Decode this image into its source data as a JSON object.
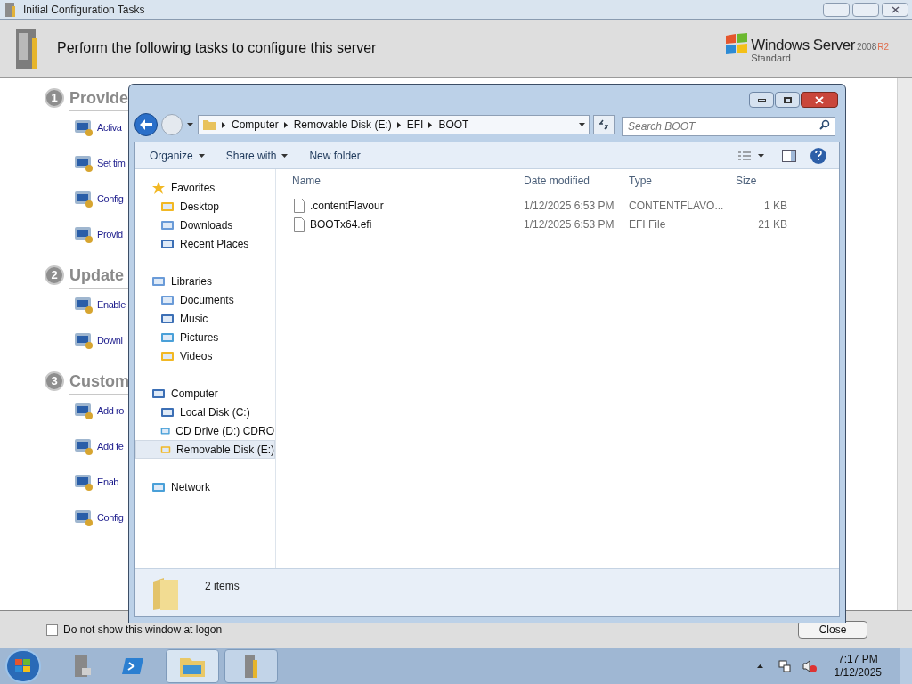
{
  "background_window": {
    "title": "Initial Configuration Tasks",
    "header": "Perform the following tasks to configure this server",
    "logo": {
      "brand": "Windows Server",
      "version": "2008",
      "mark": "R2",
      "edition": "Standard"
    },
    "sections": [
      {
        "number": "1",
        "title": "Provide",
        "items": [
          "Activa",
          "Set tim",
          "Config",
          "Provid"
        ]
      },
      {
        "number": "2",
        "title": "Update",
        "items": [
          "Enable",
          "Downl"
        ]
      },
      {
        "number": "3",
        "title": "Custom",
        "items": [
          "Add ro",
          "Add fe",
          "Enab",
          "Config"
        ]
      }
    ],
    "footer": {
      "checkbox_label": "Do not show this window at logon",
      "checked": false,
      "close_button": "Close"
    }
  },
  "explorer": {
    "breadcrumb": [
      "Computer",
      "Removable Disk (E:)",
      "EFI",
      "BOOT"
    ],
    "search_placeholder": "Search BOOT",
    "toolbar": [
      {
        "label": "Organize",
        "dropdown": true
      },
      {
        "label": "Share with",
        "dropdown": true
      },
      {
        "label": "New folder",
        "dropdown": false
      }
    ],
    "nav": [
      {
        "label": "Favorites",
        "children": [
          {
            "label": "Desktop",
            "selected": false
          },
          {
            "label": "Downloads",
            "selected": false
          },
          {
            "label": "Recent Places",
            "selected": false
          }
        ]
      },
      {
        "label": "Libraries",
        "children": [
          {
            "label": "Documents",
            "selected": false
          },
          {
            "label": "Music",
            "selected": false
          },
          {
            "label": "Pictures",
            "selected": false
          },
          {
            "label": "Videos",
            "selected": false
          }
        ]
      },
      {
        "label": "Computer",
        "children": [
          {
            "label": "Local Disk (C:)",
            "selected": false
          },
          {
            "label": "CD Drive (D:) CDRO",
            "selected": false
          },
          {
            "label": "Removable Disk (E:)",
            "selected": true
          }
        ]
      },
      {
        "label": "Network"
      }
    ],
    "columns": [
      "Name",
      "Date modified",
      "Type",
      "Size"
    ],
    "rows": [
      {
        "name": ".contentFlavour",
        "date": "1/12/2025 6:53 PM",
        "type": "CONTENTFLAVO...",
        "size": "1 KB"
      },
      {
        "name": "BOOTx64.efi",
        "date": "1/12/2025 6:53 PM",
        "type": "EFI File",
        "size": "21 KB"
      }
    ],
    "status": "2 items"
  },
  "taskbar": {
    "time": "7:17 PM",
    "date": "1/12/2025"
  }
}
